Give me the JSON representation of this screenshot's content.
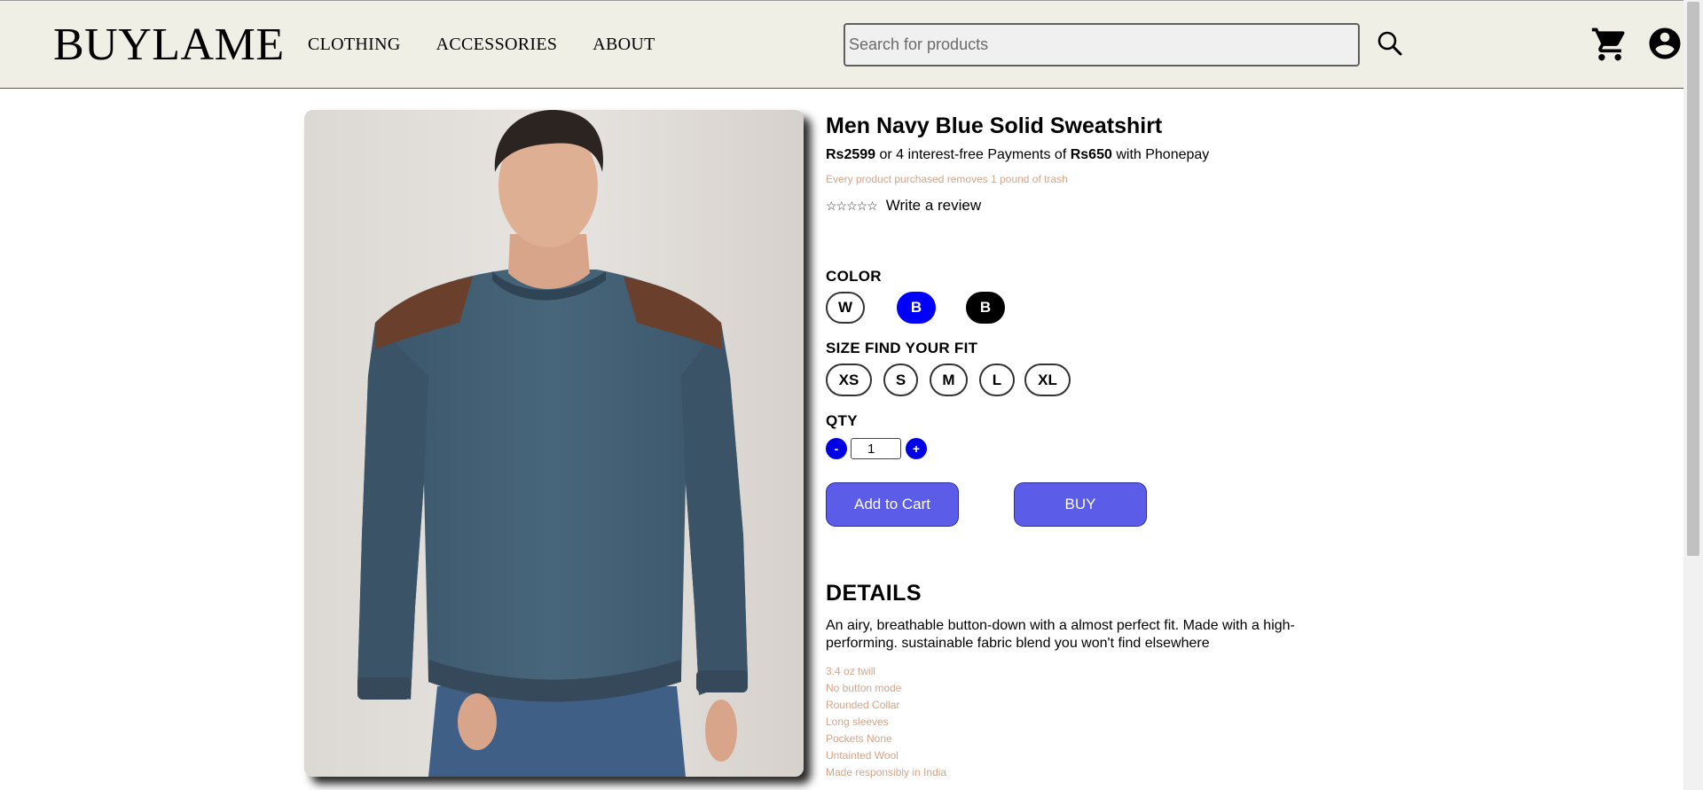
{
  "header": {
    "logo": "BUYLAME",
    "nav": [
      "CLOTHING",
      "ACCESSORIES",
      "ABOUT"
    ],
    "search": {
      "placeholder": "Search for products",
      "value": ""
    },
    "icons": [
      "search-icon",
      "cart-icon",
      "account-icon"
    ]
  },
  "product": {
    "title": "Men Navy Blue Solid Sweatshirt",
    "price": "Rs2599",
    "installment_text": "or 4 interest-free Payments of",
    "installment_amount": "Rs650",
    "installment_provider": "with Phonepay",
    "trash_note": "Every product purchased removes 1 pound of trash",
    "stars": "☆☆☆☆☆",
    "review_link": "Write a review",
    "rating": 0
  },
  "color": {
    "label": "COLOR",
    "options": [
      {
        "label": "W",
        "bg": "#ffffff",
        "fg": "#000000",
        "selected": false
      },
      {
        "label": "B",
        "bg": "#0000ff",
        "fg": "#ffffff",
        "selected": true
      },
      {
        "label": "B",
        "bg": "#000000",
        "fg": "#ffffff",
        "selected": false
      }
    ]
  },
  "size": {
    "label": "SIZE FIND YOUR FIT",
    "options": [
      "XS",
      "S",
      "M",
      "L",
      "XL"
    ]
  },
  "qty": {
    "label": "QTY",
    "minus": "-",
    "plus": "+",
    "value": "1"
  },
  "actions": {
    "add_to_cart": "Add to Cart",
    "buy": "BUY"
  },
  "details": {
    "heading": "DETAILS",
    "text": "An airy, breathable button-down with a almost perfect fit. Made with a high-performing. sustainable fabric blend you won't find elsewhere",
    "features": [
      "3.4 oz twill",
      "No button mode",
      "Rounded Collar",
      "Long sleeves",
      "Pockets None",
      "Untainted Wool",
      "Made responsibly in India"
    ]
  },
  "colors": {
    "header_bg": "#efefe6",
    "accent_blue": "#0000e6",
    "button_purple": "#5b5ce8",
    "muted_text": "#d3a58b"
  }
}
